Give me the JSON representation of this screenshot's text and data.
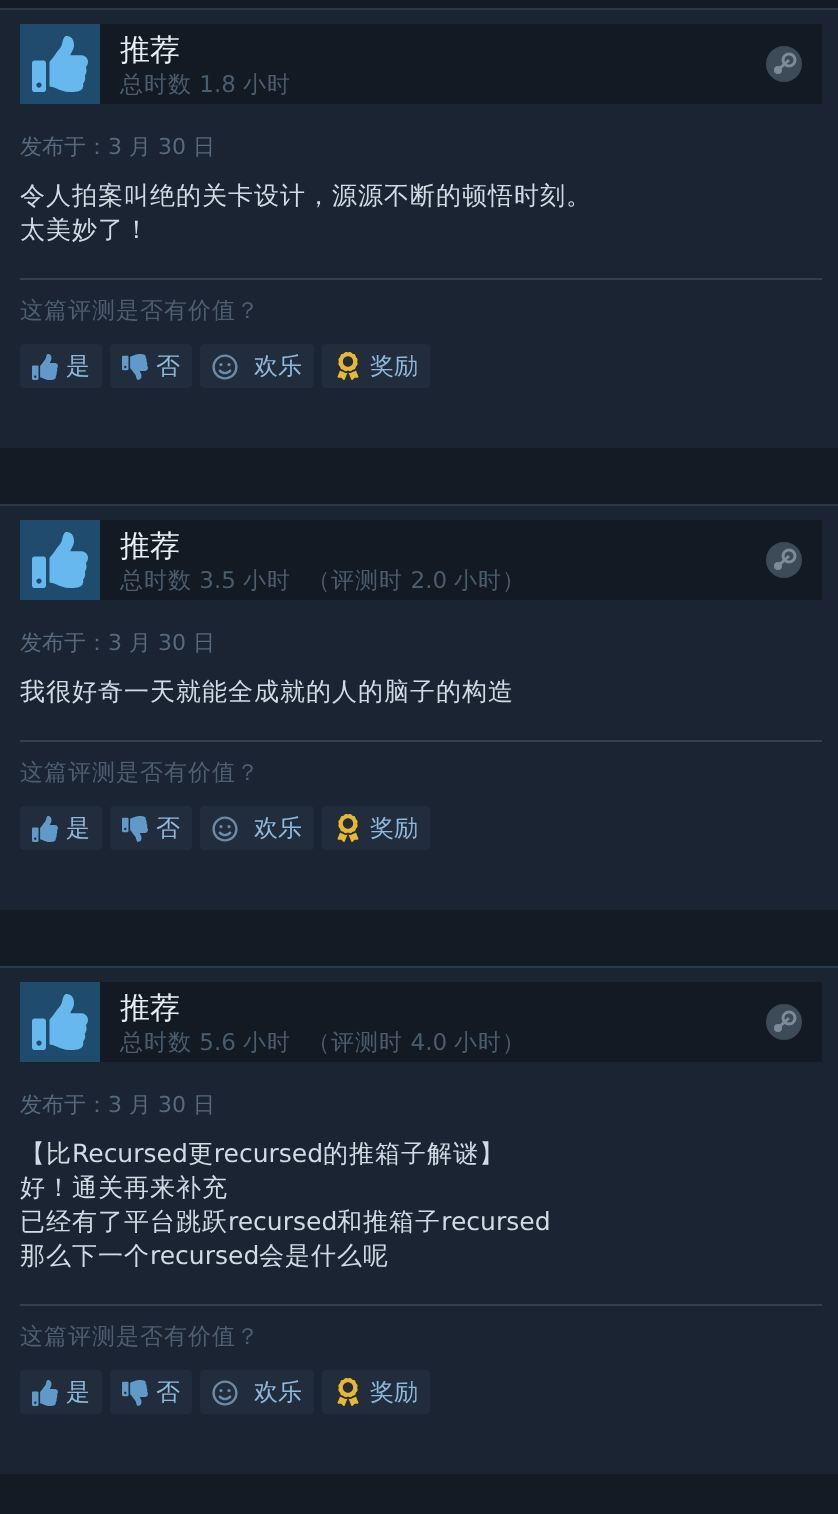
{
  "reviews": [
    {
      "verdict": "推荐",
      "hours": "总时数 1.8 小时",
      "posted": "发布于：3 月 30 日",
      "body": [
        "令人拍案叫绝的关卡设计，源源不断的顿悟时刻。",
        "太美妙了！"
      ],
      "question": "这篇评测是否有价值？",
      "buttons": [
        {
          "kind": "yes",
          "label": "是"
        },
        {
          "kind": "no",
          "label": "否"
        },
        {
          "kind": "funny",
          "label": "欢乐"
        },
        {
          "kind": "award",
          "label": "奖励"
        }
      ]
    },
    {
      "verdict": "推荐",
      "hours": "总时数 3.5 小时",
      "review_hours": "（评测时 2.0 小时）",
      "posted": "发布于：3 月 30 日",
      "body": [
        "我很好奇一天就能全成就的人的脑子的构造"
      ],
      "question": "这篇评测是否有价值？",
      "buttons": [
        {
          "kind": "yes",
          "label": "是"
        },
        {
          "kind": "no",
          "label": "否"
        },
        {
          "kind": "funny",
          "label": "欢乐"
        },
        {
          "kind": "award",
          "label": "奖励"
        }
      ]
    },
    {
      "verdict": "推荐",
      "hours": "总时数 5.6 小时",
      "review_hours": "（评测时 4.0 小时）",
      "posted": "发布于：3 月 30 日",
      "body": [
        "【比Recursed更recursed的推箱子解谜】",
        "好！通关再来补充",
        "已经有了平台跳跃recursed和推箱子recursed",
        "那么下一个recursed会是什么呢"
      ],
      "question": "这篇评测是否有价值？",
      "buttons": [
        {
          "kind": "yes",
          "label": "是"
        },
        {
          "kind": "no",
          "label": "否"
        },
        {
          "kind": "funny",
          "label": "欢乐"
        },
        {
          "kind": "award",
          "label": "奖励"
        }
      ]
    }
  ]
}
